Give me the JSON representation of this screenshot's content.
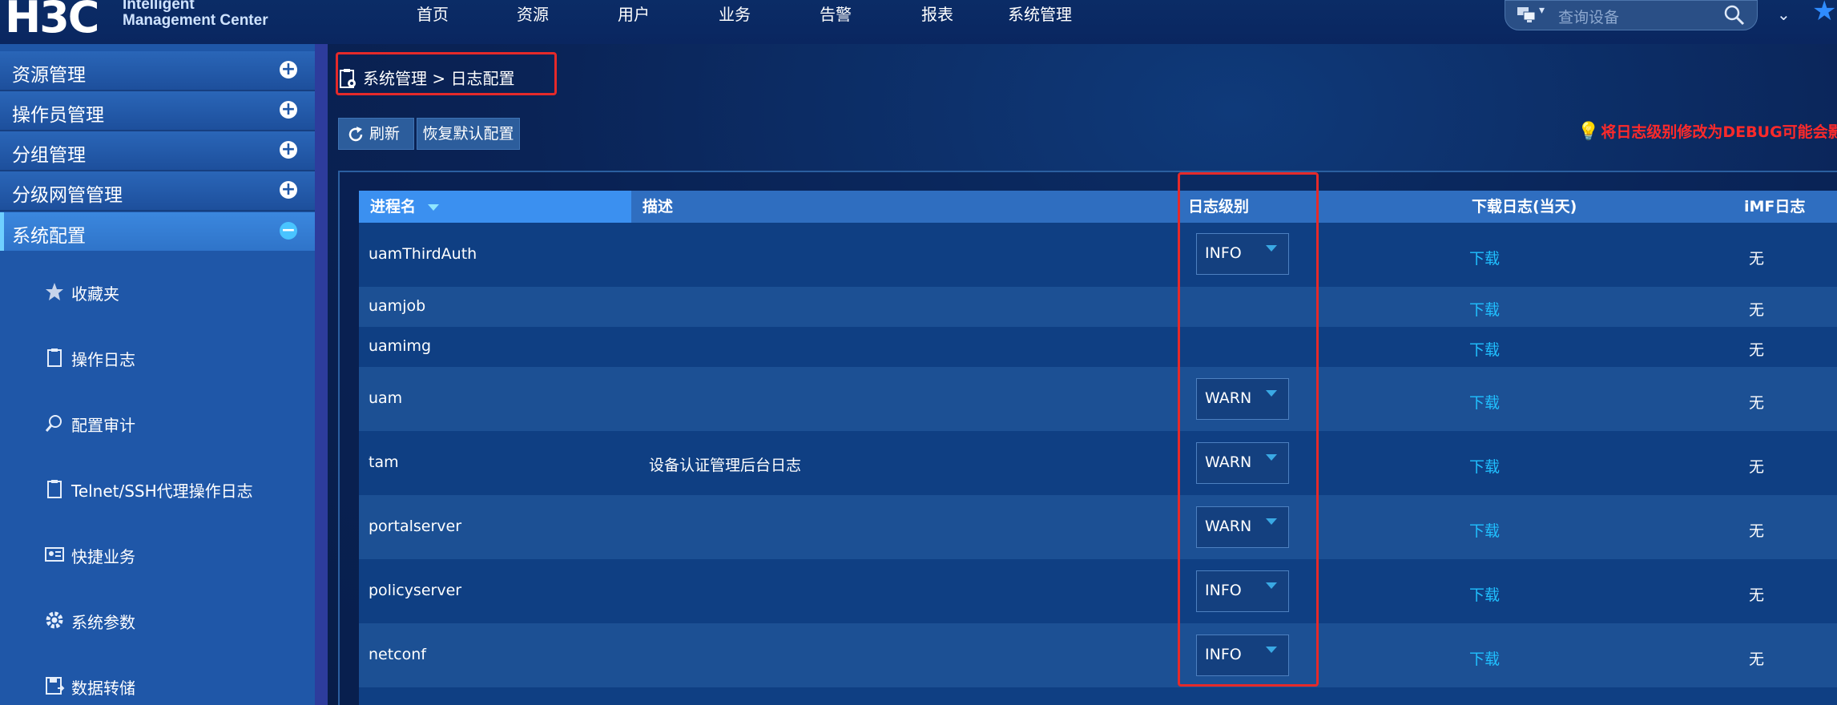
{
  "header": {
    "logo": "H3C",
    "logo_line1": "Intelligent",
    "logo_line2": "Management Center",
    "nav": [
      "首页",
      "资源",
      "用户",
      "业务",
      "告警",
      "报表",
      "系统管理"
    ],
    "search_placeholder": "查询设备"
  },
  "sidebar": {
    "sections": [
      {
        "label": "资源管理",
        "state": "collapsed"
      },
      {
        "label": "操作员管理",
        "state": "collapsed"
      },
      {
        "label": "分组管理",
        "state": "collapsed"
      },
      {
        "label": "分级网管管理",
        "state": "collapsed"
      },
      {
        "label": "系统配置",
        "state": "expanded"
      }
    ],
    "sub_items": [
      "收藏夹",
      "操作日志",
      "配置审计",
      "Telnet/SSH代理操作日志",
      "快捷业务",
      "系统参数",
      "数据转储"
    ]
  },
  "breadcrumb": {
    "text": "系统管理 > 日志配置"
  },
  "toolbar": {
    "refresh": "刷新",
    "restore": "恢复默认配置"
  },
  "tip": "将日志级别修改为DEBUG可能会影响",
  "table": {
    "columns": [
      "进程名",
      "描述",
      "日志级别",
      "下载日志(当天)",
      "iMF日志"
    ],
    "rows": [
      {
        "name": "uamThirdAuth",
        "desc": "",
        "level": "INFO",
        "download": "下载",
        "imf": "无"
      },
      {
        "name": "uamjob",
        "desc": "",
        "level": "",
        "download": "下载",
        "imf": "无"
      },
      {
        "name": "uamimg",
        "desc": "",
        "level": "",
        "download": "下载",
        "imf": "无"
      },
      {
        "name": "uam",
        "desc": "",
        "level": "WARN",
        "download": "下载",
        "imf": "无"
      },
      {
        "name": "tam",
        "desc": "设备认证管理后台日志",
        "level": "WARN",
        "download": "下载",
        "imf": "无"
      },
      {
        "name": "portalserver",
        "desc": "",
        "level": "WARN",
        "download": "下载",
        "imf": "无"
      },
      {
        "name": "policyserver",
        "desc": "",
        "level": "INFO",
        "download": "下载",
        "imf": "无"
      },
      {
        "name": "netconf",
        "desc": "",
        "level": "INFO",
        "download": "下载",
        "imf": "无"
      }
    ]
  },
  "colors": {
    "accent": "#2f8cff",
    "highlight": "#e52a2a",
    "link": "#20c0ff"
  }
}
